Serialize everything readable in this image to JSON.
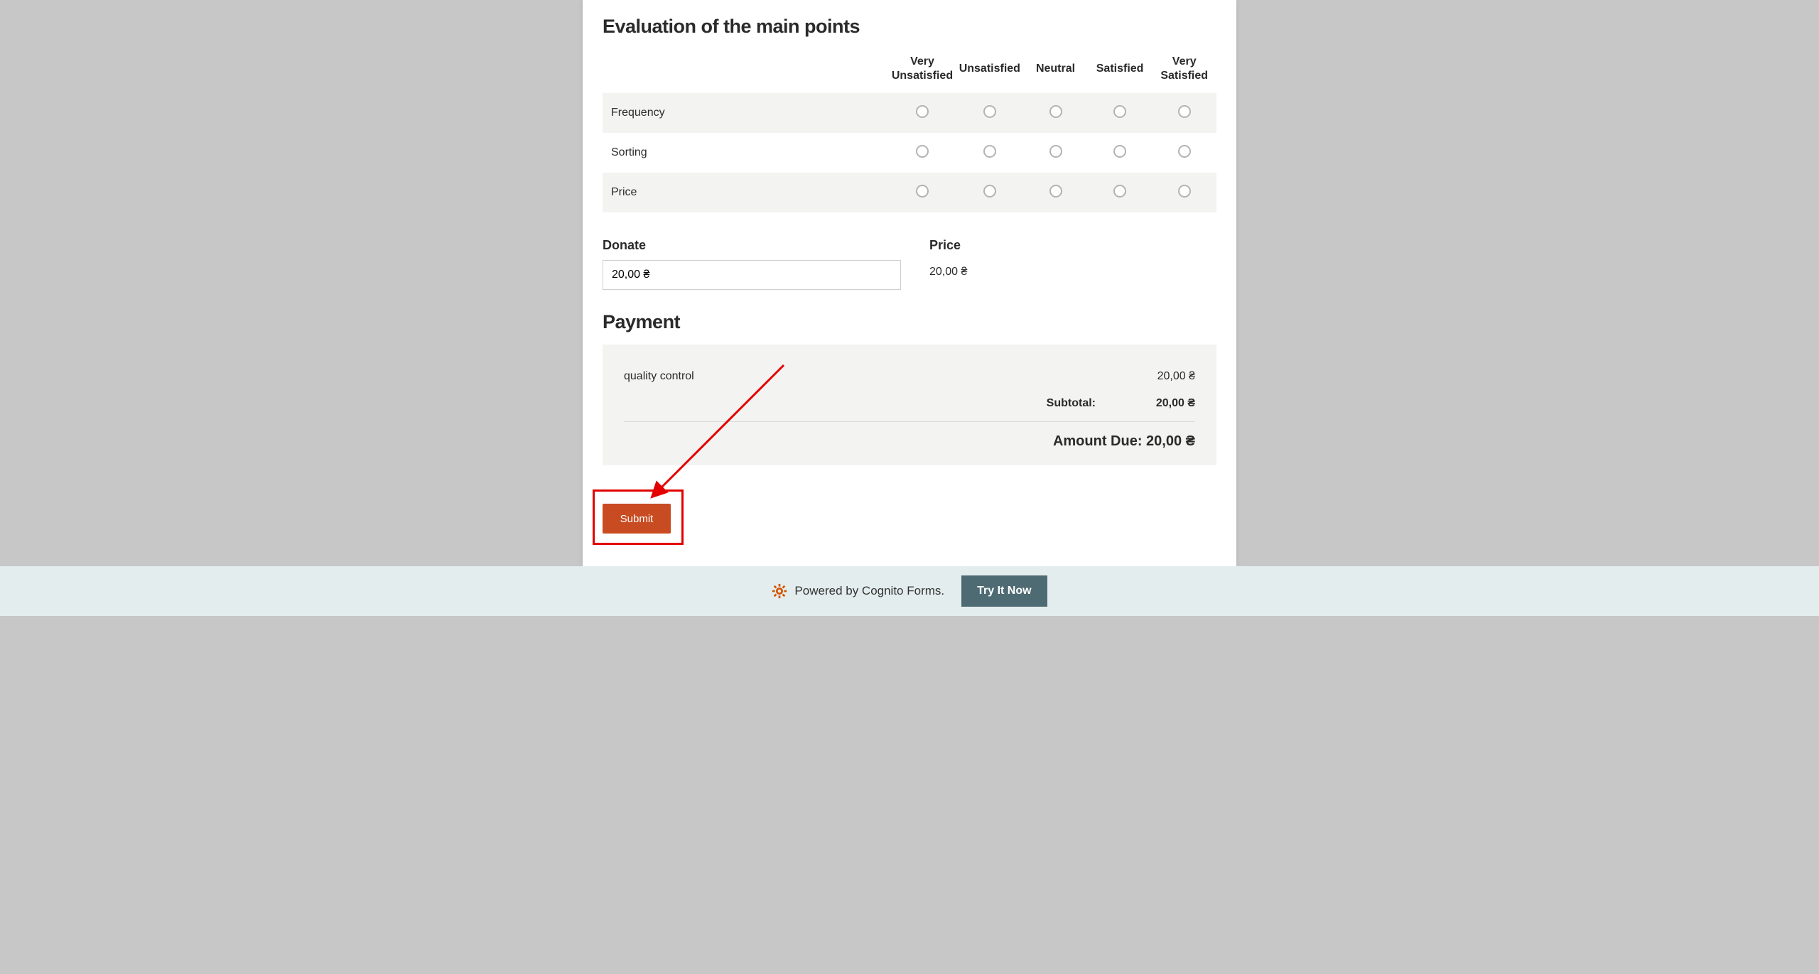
{
  "evaluation": {
    "heading": "Evaluation of the main points",
    "columns": [
      "Very Unsatisfied",
      "Unsatisfied",
      "Neutral",
      "Satisfied",
      "Very Satisfied"
    ],
    "rows": [
      "Frequency",
      "Sorting",
      "Price"
    ]
  },
  "donate": {
    "label": "Donate",
    "value": "20,00 ₴"
  },
  "price": {
    "label": "Price",
    "value": "20,00 ₴"
  },
  "payment": {
    "heading": "Payment",
    "line_items": [
      {
        "name": "quality control",
        "amount": "20,00 ₴"
      }
    ],
    "subtotal_label": "Subtotal:",
    "subtotal_value": "20,00 ₴",
    "amount_due_label": "Amount Due:",
    "amount_due_value": "20,00 ₴"
  },
  "submit": {
    "label": "Submit"
  },
  "footer": {
    "powered_by": "Powered by Cognito Forms.",
    "try_label": "Try It Now"
  }
}
